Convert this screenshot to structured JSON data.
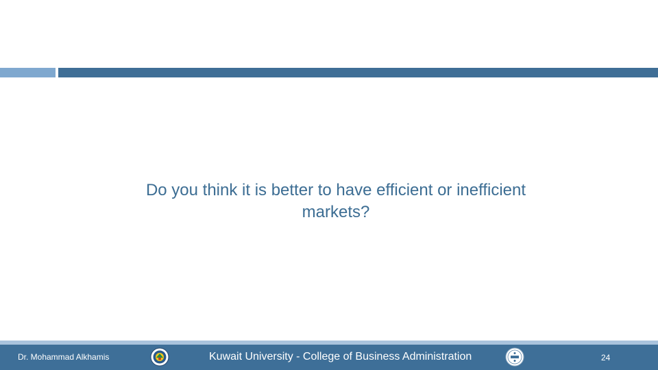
{
  "slide": {
    "question": "Do you think it is better to have efficient or inefficient markets?",
    "author": "Dr. Mohammad Alkhamis",
    "institution": "Kuwait University - College of Business Administration",
    "page_number": "24"
  },
  "colors": {
    "accent_dark": "#3e6f98",
    "accent_light": "#7fa8cf",
    "text": "#3c6d93"
  },
  "icons": {
    "left_logo": "kuwait-university-seal",
    "right_logo": "aacsb-accreditation-seal"
  }
}
